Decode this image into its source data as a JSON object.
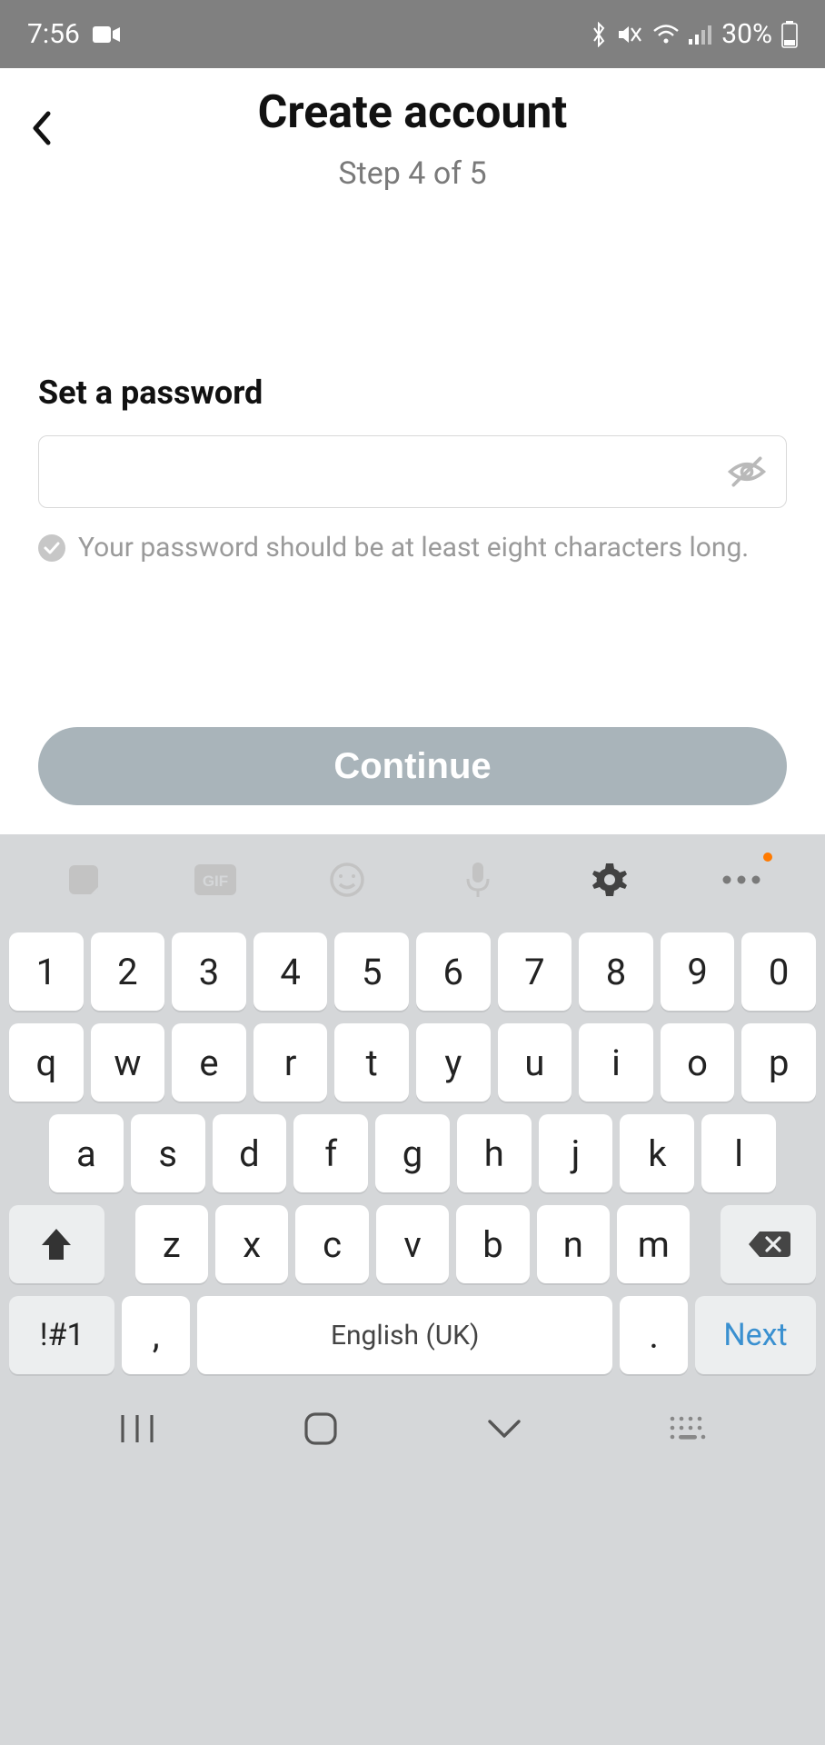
{
  "status": {
    "time": "7:56",
    "battery": "30%"
  },
  "header": {
    "title": "Create account",
    "step": "Step 4 of 5"
  },
  "form": {
    "label": "Set a password",
    "value": "",
    "hint": "Your password should be at least eight characters long."
  },
  "continue_label": "Continue",
  "keyboard": {
    "numbers": [
      "1",
      "2",
      "3",
      "4",
      "5",
      "6",
      "7",
      "8",
      "9",
      "0"
    ],
    "row_qwerty": [
      "q",
      "w",
      "e",
      "r",
      "t",
      "y",
      "u",
      "i",
      "o",
      "p"
    ],
    "row_home": [
      "a",
      "s",
      "d",
      "f",
      "g",
      "h",
      "j",
      "k",
      "l"
    ],
    "row_zxcv": [
      "z",
      "x",
      "c",
      "v",
      "b",
      "n",
      "m"
    ],
    "sym": "!#1",
    "comma": ",",
    "space": "English (UK)",
    "dot": ".",
    "next": "Next"
  }
}
